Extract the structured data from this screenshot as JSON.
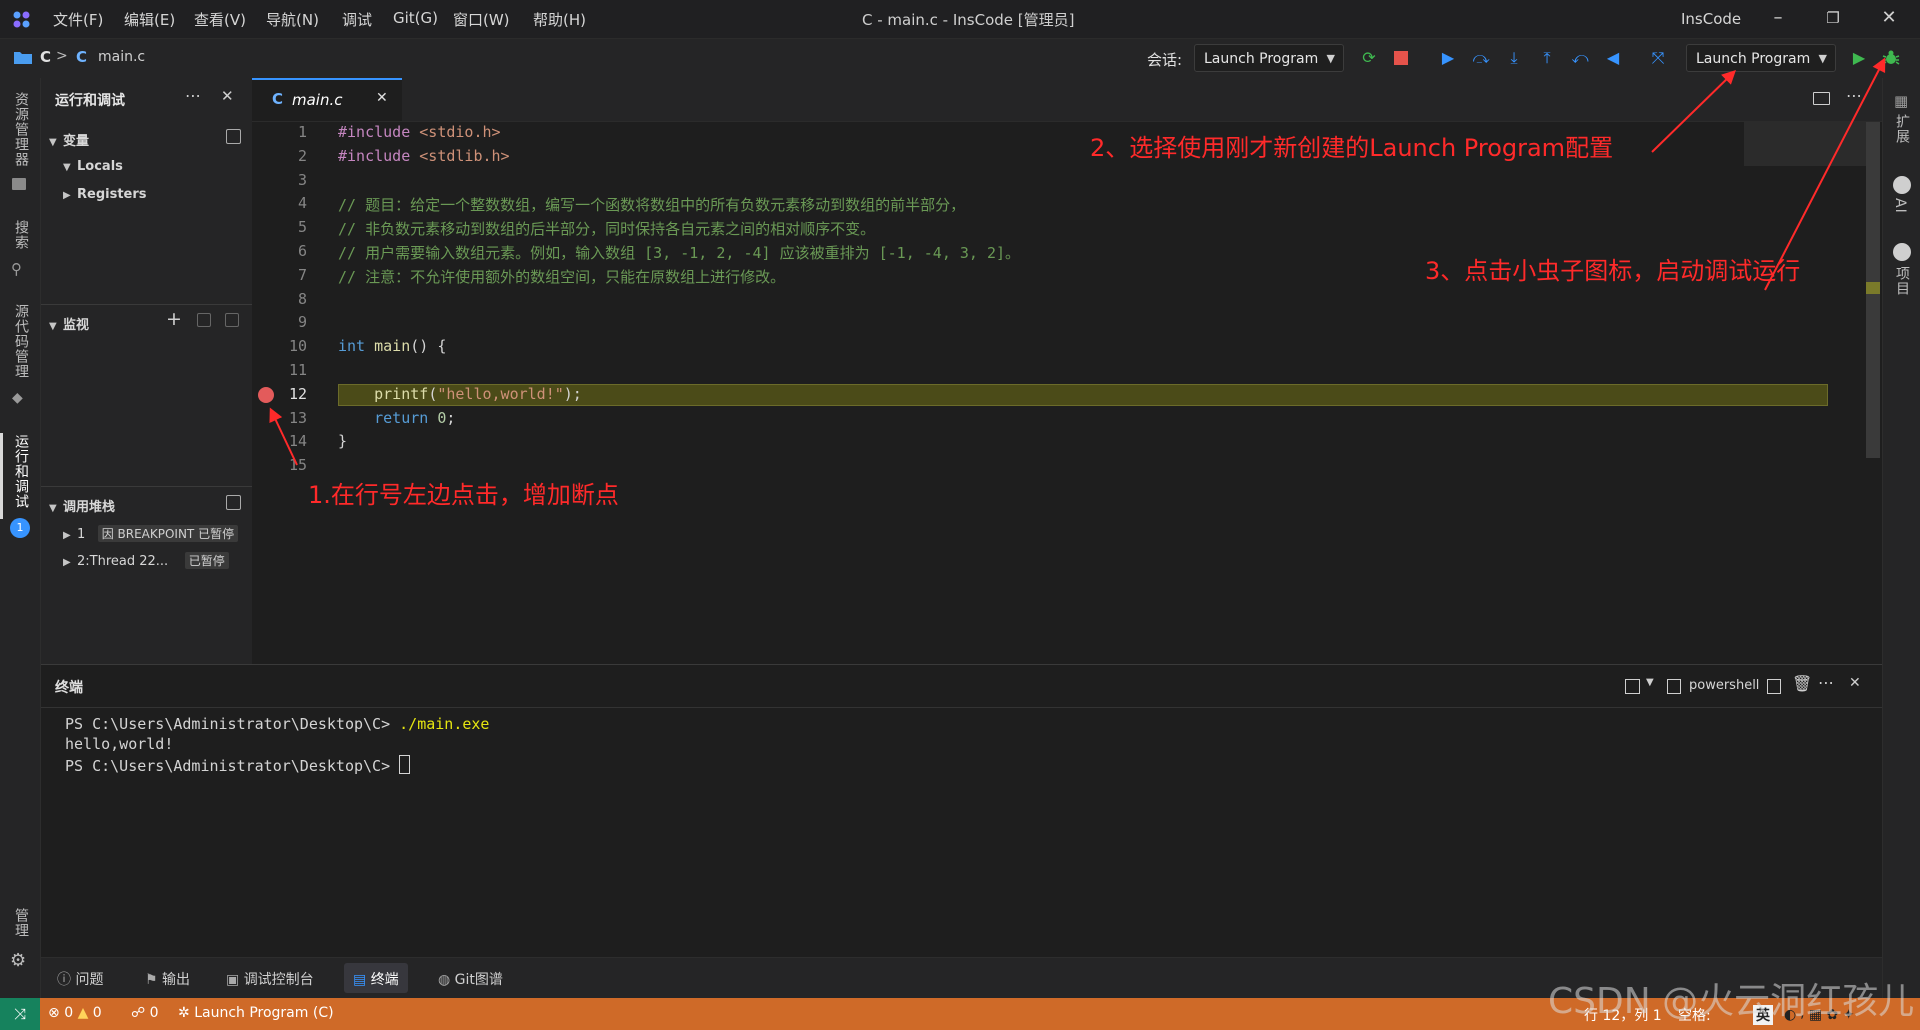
{
  "titlebar": {
    "menus": [
      "文件(F)",
      "编辑(E)",
      "查看(V)",
      "导航(N)",
      "调试",
      "Git(G)",
      "窗口(W)",
      "帮助(H)"
    ],
    "window_title": "C - main.c - InsCode [管理员]",
    "brand": "InsCode"
  },
  "toolbar": {
    "breadcrumb_folder": "C",
    "breadcrumb_sep": ">",
    "breadcrumb_file_icon": "C",
    "breadcrumb_file": "main.c",
    "session_label": "会话:",
    "session_value": "Launch Program",
    "config_value": "Launch Program"
  },
  "activity": {
    "items": [
      "资源管理器",
      "搜索",
      "源代码管理",
      "运行和调试",
      "管理"
    ],
    "debug_badge": "1"
  },
  "rightbar": {
    "items": [
      "扩展",
      "AI",
      "项目"
    ]
  },
  "sidepanel": {
    "title": "运行和调试",
    "variables": "变量",
    "locals": "Locals",
    "registers": "Registers",
    "watch": "监视",
    "callstack": "调用堆栈",
    "stack": [
      {
        "index": "1",
        "badge": "因 BREAKPOINT 已暂停"
      },
      {
        "index": "2:Thread 22...",
        "badge": "已暂停"
      }
    ]
  },
  "editor": {
    "tab_icon": "C",
    "tab_label": "main.c",
    "lines": [
      {
        "n": "1",
        "parts": [
          [
            "inc",
            "#include "
          ],
          [
            "str",
            "<stdio.h>"
          ]
        ]
      },
      {
        "n": "2",
        "parts": [
          [
            "inc",
            "#include "
          ],
          [
            "str",
            "<stdlib.h>"
          ]
        ]
      },
      {
        "n": "3",
        "parts": []
      },
      {
        "n": "4",
        "parts": [
          [
            "cmt",
            "// 题目：给定一个整数数组，编写一个函数将数组中的所有负数元素移动到数组的前半部分，"
          ]
        ]
      },
      {
        "n": "5",
        "parts": [
          [
            "cmt",
            "// 非负数元素移动到数组的后半部分，同时保持各自元素之间的相对顺序不变。"
          ]
        ]
      },
      {
        "n": "6",
        "parts": [
          [
            "cmt",
            "// 用户需要输入数组元素。例如，输入数组 [3, -1, 2, -4] 应该被重排为 [-1, -4, 3, 2]。"
          ]
        ]
      },
      {
        "n": "7",
        "parts": [
          [
            "cmt",
            "// 注意：不允许使用额外的数组空间，只能在原数组上进行修改。"
          ]
        ]
      },
      {
        "n": "8",
        "parts": []
      },
      {
        "n": "9",
        "parts": []
      },
      {
        "n": "10",
        "parts": [
          [
            "kw",
            "int "
          ],
          [
            "fn",
            "main"
          ],
          [
            "plain",
            "() {"
          ]
        ]
      },
      {
        "n": "11",
        "parts": []
      },
      {
        "n": "12",
        "parts": [
          [
            "plain",
            "    "
          ],
          [
            "fn",
            "printf"
          ],
          [
            "plain",
            "("
          ],
          [
            "str",
            "\"hello,world!\""
          ],
          [
            "plain",
            ");"
          ]
        ]
      },
      {
        "n": "13",
        "parts": [
          [
            "plain",
            "    "
          ],
          [
            "kw",
            "return "
          ],
          [
            "num",
            "0"
          ],
          [
            "plain",
            ";"
          ]
        ]
      },
      {
        "n": "14",
        "parts": [
          [
            "plain",
            "}"
          ]
        ]
      },
      {
        "n": "15",
        "parts": []
      }
    ]
  },
  "annotations": {
    "a1": "1.在行号左边点击，增加断点",
    "a2": "2、选择使用刚才新创建的Launch Program配置",
    "a3": "3、点击小虫子图标，启动调试运行"
  },
  "terminal": {
    "title": "终端",
    "shell": "powershell",
    "lines": [
      {
        "prompt": "PS C:\\Users\\Administrator\\Desktop\\C> ",
        "cmd": "./main.exe"
      },
      {
        "prompt": "hello,world!",
        "cmd": ""
      },
      {
        "prompt": "PS C:\\Users\\Administrator\\Desktop\\C> ",
        "cmd": ""
      }
    ]
  },
  "bottomtabs": [
    "问题",
    "输出",
    "调试控制台",
    "终端",
    "Git图谱"
  ],
  "statusbar": {
    "errors": "0",
    "warnings": "0",
    "ports": "0",
    "launch": "Launch Program (C)",
    "position": "行 12，列 1",
    "spaces": "空格:",
    "ime": "英"
  },
  "watermark": "CSDN @火云洞红孩儿",
  "colors": {
    "accent": "#3794ff",
    "statusbar": "#cf6a28",
    "breakpoint": "#e35b5b",
    "annotation": "#ff2a2a",
    "run_green": "#3fb950"
  }
}
